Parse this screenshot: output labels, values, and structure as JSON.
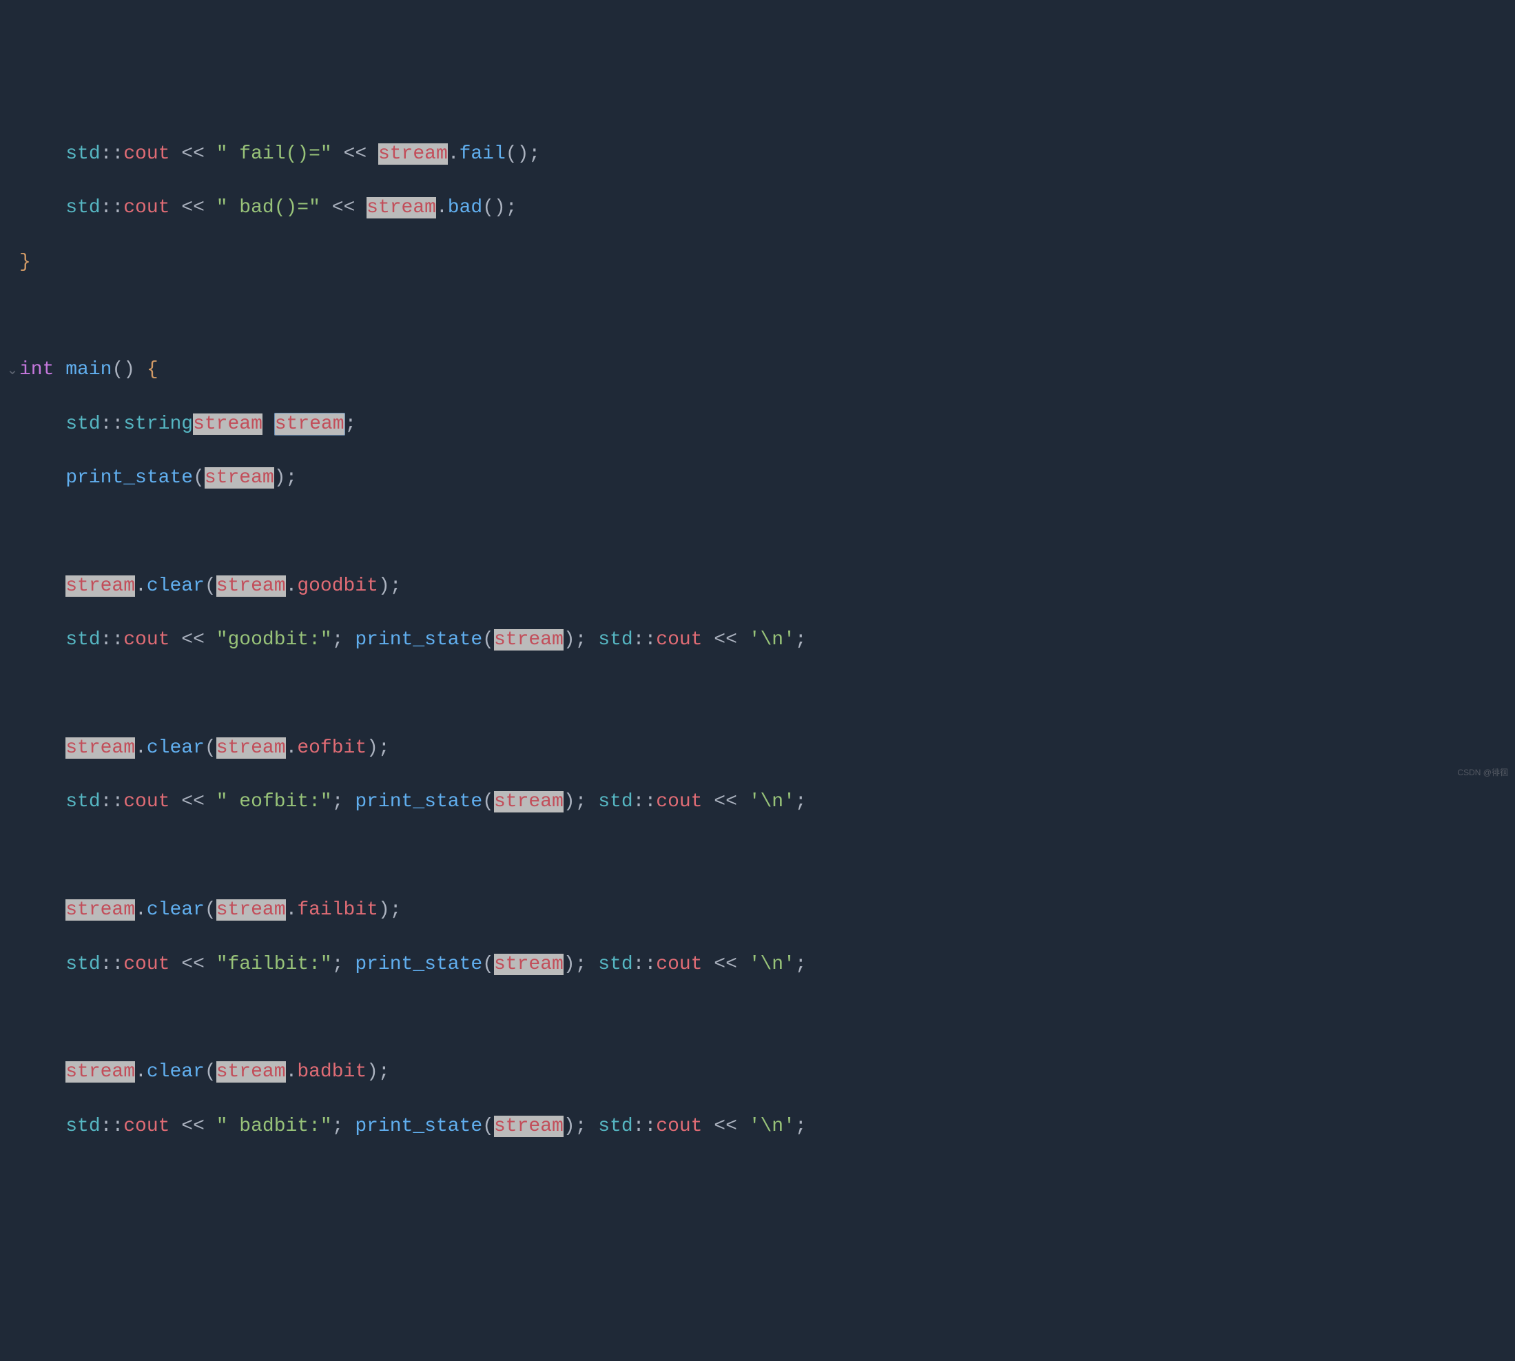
{
  "watermark": "CSDN @徘徊",
  "lines": {
    "l1": {
      "ns": "std",
      "op": "::",
      "cout": "cout",
      "lt": " << ",
      "str": "\" fail()=\"",
      "stream": "stream",
      "dot": ".",
      "method": "fail",
      "paren": "();"
    },
    "l2": {
      "ns": "std",
      "op": "::",
      "cout": "cout",
      "lt": " << ",
      "str": "\" bad()=\"",
      "stream": "stream",
      "dot": ".",
      "method": "bad",
      "paren": "();"
    },
    "l3": {
      "brace": "}"
    },
    "l5": {
      "kw": "int",
      "fn": " main",
      "paren": "() ",
      "brace": "{"
    },
    "l6": {
      "ns": "std",
      "op": "::",
      "type": "string",
      "stream1": "stream",
      "space": " ",
      "stream2": "stream",
      "semi": ";"
    },
    "l7": {
      "fn": "print_state",
      "open": "(",
      "stream": "stream",
      "close": ");"
    },
    "l9": {
      "stream": "stream",
      "dot": ".",
      "clear": "clear",
      "open": "(",
      "stream2": "stream",
      "dot2": ".",
      "bit": "goodbit",
      "close": ");"
    },
    "l10": {
      "ns": "std",
      "op": "::",
      "cout": "cout",
      "lt": " << ",
      "str": "\"goodbit:\"",
      "semi": "; ",
      "fn": "print_state",
      "open": "(",
      "stream": "stream",
      "close": "); ",
      "ns2": "std",
      "op2": "::",
      "cout2": "cout",
      "lt2": " << ",
      "char": "'\\n'",
      "semi2": ";"
    },
    "l12": {
      "stream": "stream",
      "dot": ".",
      "clear": "clear",
      "open": "(",
      "stream2": "stream",
      "dot2": ".",
      "bit": "eofbit",
      "close": ");"
    },
    "l13": {
      "ns": "std",
      "op": "::",
      "cout": "cout",
      "lt": " << ",
      "str": "\" eofbit:\"",
      "semi": "; ",
      "fn": "print_state",
      "open": "(",
      "stream": "stream",
      "close": "); ",
      "ns2": "std",
      "op2": "::",
      "cout2": "cout",
      "lt2": " << ",
      "char": "'\\n'",
      "semi2": ";"
    },
    "l15": {
      "stream": "stream",
      "dot": ".",
      "clear": "clear",
      "open": "(",
      "stream2": "stream",
      "dot2": ".",
      "bit": "failbit",
      "close": ");"
    },
    "l16": {
      "ns": "std",
      "op": "::",
      "cout": "cout",
      "lt": " << ",
      "str": "\"failbit:\"",
      "semi": "; ",
      "fn": "print_state",
      "open": "(",
      "stream": "stream",
      "close": "); ",
      "ns2": "std",
      "op2": "::",
      "cout2": "cout",
      "lt2": " << ",
      "char": "'\\n'",
      "semi2": ";"
    },
    "l18": {
      "stream": "stream",
      "dot": ".",
      "clear": "clear",
      "open": "(",
      "stream2": "stream",
      "dot2": ".",
      "bit": "badbit",
      "close": ");"
    },
    "l19": {
      "ns": "std",
      "op": "::",
      "cout": "cout",
      "lt": " << ",
      "str": "\" badbit:\"",
      "semi": "; ",
      "fn": "print_state",
      "open": "(",
      "stream": "stream",
      "close": "); ",
      "ns2": "std",
      "op2": "::",
      "cout2": "cout",
      "lt2": " << ",
      "char": "'\\n'",
      "semi2": ";"
    }
  }
}
